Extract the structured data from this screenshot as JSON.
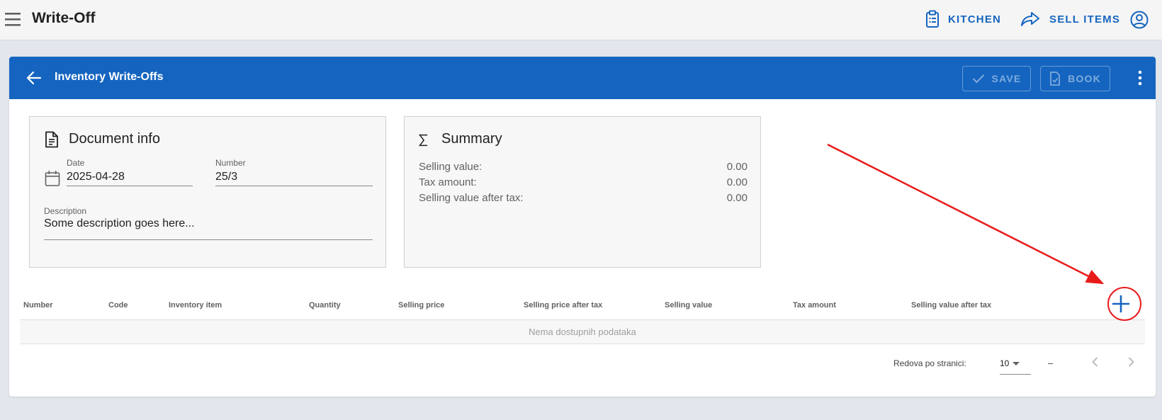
{
  "app": {
    "title": "Write-Off",
    "menu_icon": "menu-icon",
    "actions": [
      {
        "label": "KITCHEN",
        "icon": "clipboard-list-icon"
      },
      {
        "label": "SELL ITEMS",
        "icon": "share-forward-icon"
      }
    ],
    "account_icon": "account-circle-icon"
  },
  "toolbar": {
    "title": "Inventory Write-Offs",
    "back_icon": "arrow-left-icon",
    "save_label": "SAVE",
    "book_label": "BOOK",
    "more_icon": "dots-vertical-icon"
  },
  "document_info": {
    "title": "Document info",
    "date_label": "Date",
    "date_value": "2025-04-28",
    "number_label": "Number",
    "number_value": "25/3",
    "description_label": "Description",
    "description_value": "Some description goes here..."
  },
  "summary": {
    "title": "Summary",
    "rows": [
      {
        "label": "Selling value:",
        "value": "0.00"
      },
      {
        "label": "Tax amount:",
        "value": "0.00"
      },
      {
        "label": "Selling value after tax:",
        "value": "0.00"
      }
    ]
  },
  "table": {
    "columns": [
      "Number",
      "Code",
      "Inventory item",
      "Quantity",
      "Selling price",
      "Selling price after tax",
      "Selling value",
      "Tax amount",
      "Selling value after tax"
    ],
    "empty_text": "Nema dostupnih podataka",
    "add_icon": "plus-icon"
  },
  "pagination": {
    "rows_per_page_label": "Redova po stranici:",
    "rows_per_page_value": "10",
    "range_text": "–"
  },
  "colors": {
    "primary": "#1565c0",
    "annotation": "#e81b1b",
    "background": "#e4e6ee"
  }
}
